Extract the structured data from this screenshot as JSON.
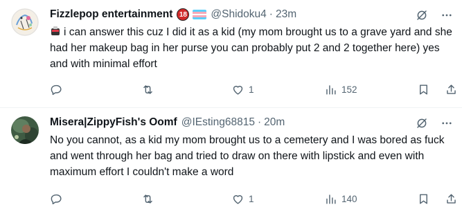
{
  "tweets": [
    {
      "name": "Fizzlepop entertainment",
      "badge": "18",
      "handle": "@Shidoku4",
      "dot": "·",
      "time": "23m",
      "text": "i can answer this cuz I did it as a kid (my mom brought us to a grave yard and she had her makeup bag in her purse you can probably put 2 and 2 together here) yes and with minimal effort",
      "reply_count": "",
      "repost_count": "",
      "like_count": "1",
      "view_count": "152"
    },
    {
      "name": "Misera|ZippyFish's Oomf",
      "handle": "@IEsting68815",
      "dot": "·",
      "time": "20m",
      "text": "No you cannot, as a kid my mom brought us to a cemetery and I was bored as fuck and went through her bag and tried to draw on there with lipstick and even with maximum effort I couldn't make a word",
      "reply_count": "",
      "repost_count": "",
      "like_count": "1",
      "view_count": "140"
    }
  ],
  "icons": {
    "grok": "grok-icon",
    "more": "more-icon",
    "reply": "reply-icon",
    "repost": "repost-icon",
    "like": "heart-icon",
    "views": "views-icon",
    "bookmark": "bookmark-icon",
    "share": "share-icon"
  },
  "colors": {
    "text": "#0f1419",
    "secondary": "#536471",
    "divider": "#eff3f4",
    "badge18": "#d12a2a",
    "trans_flag": [
      "#5bcefa",
      "#f5a9b8",
      "#ffffff",
      "#f5a9b8",
      "#5bcefa"
    ]
  }
}
